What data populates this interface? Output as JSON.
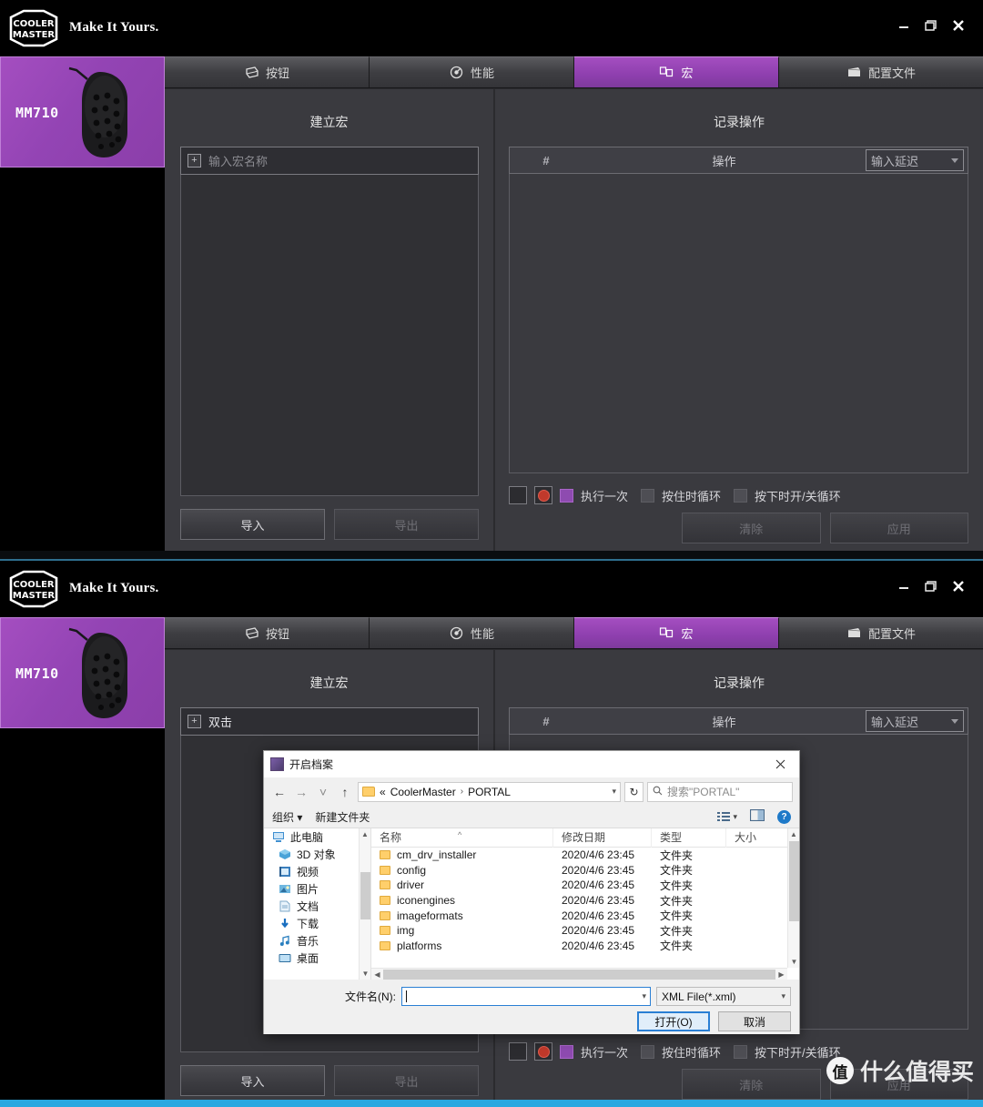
{
  "app": {
    "brand_line1": "COOLER",
    "brand_line2": "MASTER",
    "tagline": "Make It Yours.",
    "accent_color": "#9344b4",
    "window_buttons": {
      "minimize": "–",
      "restore": "❐",
      "close": "✕"
    }
  },
  "device": {
    "name": "MM710"
  },
  "tabs": [
    {
      "label": "按钮",
      "icon": "mouse-icon",
      "active": false
    },
    {
      "label": "性能",
      "icon": "gauge-icon",
      "active": false
    },
    {
      "label": "宏",
      "icon": "macro-icon",
      "active": true
    },
    {
      "label": "配置文件",
      "icon": "profile-icon",
      "active": false
    }
  ],
  "macro_pane": {
    "title": "建立宏",
    "name_placeholder": "输入宏名称",
    "name_value_window2": "双击",
    "add_icon": "plus-icon",
    "import_label": "导入",
    "export_label": "导出"
  },
  "record_pane": {
    "title": "记录操作",
    "col_index": "#",
    "col_action": "操作",
    "delay_label": "输入延迟",
    "stop_icon": "stop-square-icon",
    "record_icon": "record-dot-icon",
    "options": [
      {
        "label": "执行一次",
        "checked": true
      },
      {
        "label": "按住时循环",
        "checked": false
      },
      {
        "label": "按下时开/关循环",
        "checked": false
      }
    ],
    "clear_label": "清除",
    "apply_label": "应用"
  },
  "file_dialog": {
    "title": "开启档案",
    "close_icon": "close-icon",
    "nav": {
      "back": "←",
      "forward": "→",
      "recent": "˅",
      "up": "↑",
      "path_prefix": "«",
      "crumbs": [
        "CoolerMaster",
        "PORTAL"
      ],
      "refresh_icon": "refresh-icon",
      "search_placeholder": "搜索\"PORTAL\"",
      "search_icon": "search-icon"
    },
    "toolbar": {
      "organize": "组织",
      "new_folder": "新建文件夹",
      "view_icon": "view-list-icon",
      "pane_icon": "preview-pane-icon",
      "help_icon": "help-icon",
      "help_glyph": "?"
    },
    "sidebar": [
      {
        "label": "此电脑",
        "icon": "computer-icon",
        "level": 1
      },
      {
        "label": "3D 对象",
        "icon": "3d-objects-icon",
        "level": 2
      },
      {
        "label": "视频",
        "icon": "videos-icon",
        "level": 2
      },
      {
        "label": "图片",
        "icon": "pictures-icon",
        "level": 2
      },
      {
        "label": "文档",
        "icon": "documents-icon",
        "level": 2
      },
      {
        "label": "下载",
        "icon": "downloads-icon",
        "level": 2
      },
      {
        "label": "音乐",
        "icon": "music-icon",
        "level": 2
      },
      {
        "label": "桌面",
        "icon": "desktop-icon",
        "level": 2
      }
    ],
    "columns": {
      "name": "名称",
      "date": "修改日期",
      "type": "类型",
      "size": "大小"
    },
    "files": [
      {
        "name": "cm_drv_installer",
        "date": "2020/4/6 23:45",
        "type": "文件夹",
        "size": ""
      },
      {
        "name": "config",
        "date": "2020/4/6 23:45",
        "type": "文件夹",
        "size": ""
      },
      {
        "name": "driver",
        "date": "2020/4/6 23:45",
        "type": "文件夹",
        "size": ""
      },
      {
        "name": "iconengines",
        "date": "2020/4/6 23:45",
        "type": "文件夹",
        "size": ""
      },
      {
        "name": "imageformats",
        "date": "2020/4/6 23:45",
        "type": "文件夹",
        "size": ""
      },
      {
        "name": "img",
        "date": "2020/4/6 23:45",
        "type": "文件夹",
        "size": ""
      },
      {
        "name": "platforms",
        "date": "2020/4/6 23:45",
        "type": "文件夹",
        "size": ""
      }
    ],
    "filename_label": "文件名(N):",
    "filename_value": "",
    "filetype_value": "XML File(*.xml)",
    "open_label": "打开(O)",
    "cancel_label": "取消"
  },
  "watermark": {
    "badge": "值",
    "text": "什么值得买"
  }
}
